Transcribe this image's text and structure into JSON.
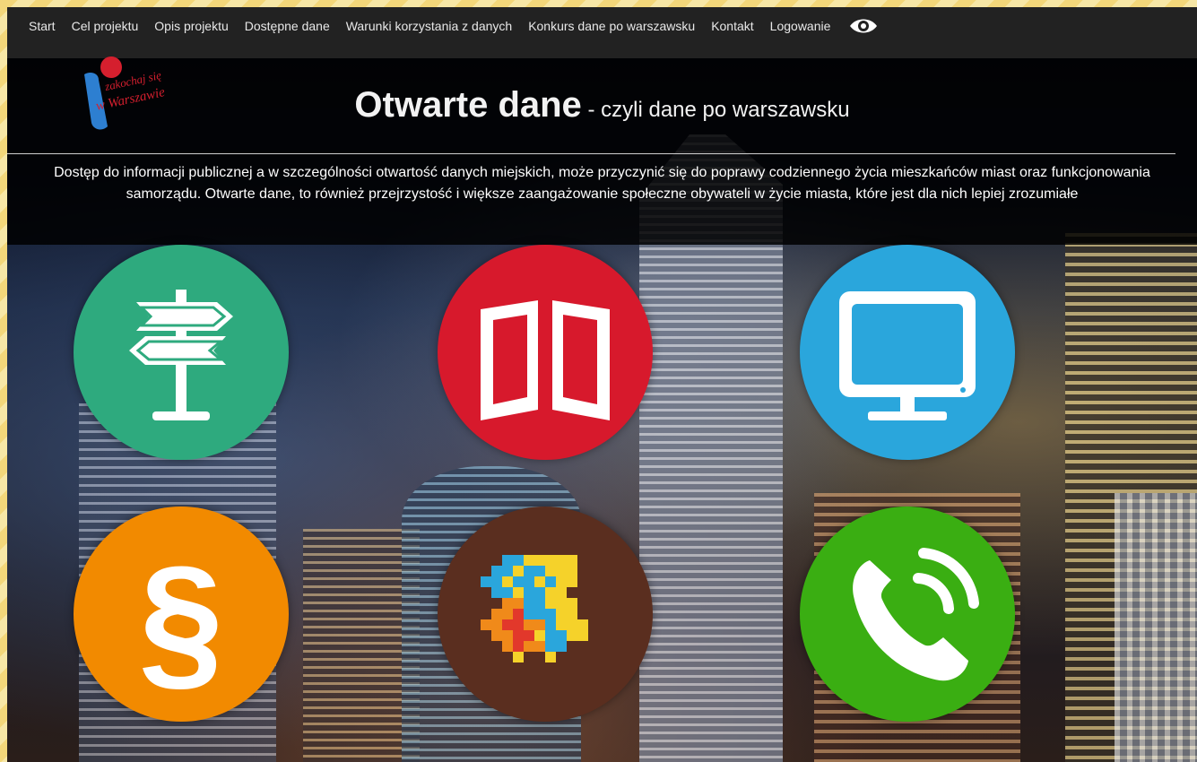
{
  "nav": {
    "items": [
      "Start",
      "Cel projektu",
      "Opis projektu",
      "Dostępne dane",
      "Warunki korzystania z danych",
      "Konkurs dane po warszawsku",
      "Kontakt",
      "Logowanie"
    ],
    "accessibility_icon": "eye-icon"
  },
  "logo": {
    "text_line1": "zakochaj się",
    "text_line2": "w Warszawie"
  },
  "header": {
    "title": "Otwarte dane",
    "subtitle": " - czyli dane po warszawsku",
    "intro": "Dostęp do informacji publicznej a w szczególności otwartość danych miejskich, może przyczynić się do poprawy codziennego życia mieszkańców miast oraz funkcjonowania samorządu. Otwarte dane, to również przejrzystość i większe zaangażowanie społeczne obywateli w życie miasta, które jest dla nich lepiej zrozumiałe"
  },
  "tiles": [
    {
      "icon": "signpost-icon",
      "color": "#2eaa7e"
    },
    {
      "icon": "book-icon",
      "color": "#d7192c"
    },
    {
      "icon": "monitor-icon",
      "color": "#2aa6dc"
    },
    {
      "icon": "paragraph-icon",
      "color": "#f28a00"
    },
    {
      "icon": "pixel-mosaic-icon",
      "color": "#5a2e1f"
    },
    {
      "icon": "phone-icon",
      "color": "#3aae12"
    }
  ],
  "colors": {
    "navbar": "#222222",
    "text": "#ffffff"
  }
}
